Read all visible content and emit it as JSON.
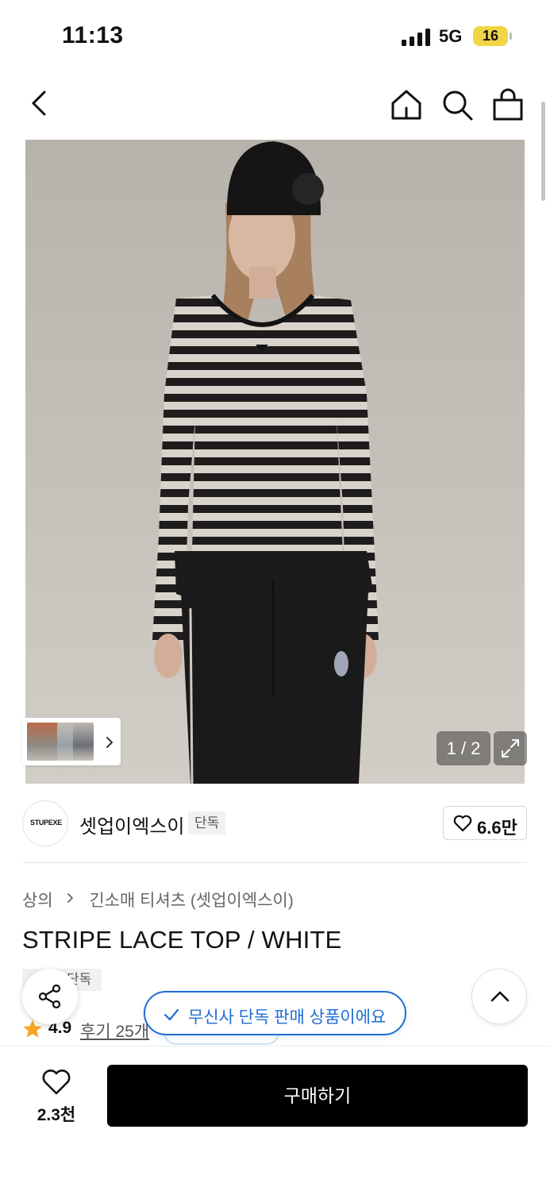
{
  "status_bar": {
    "time": "11:13",
    "network": "5G",
    "battery": "16"
  },
  "product_gallery": {
    "counter": "1 / 2",
    "colors": {
      "background": "#c3beb8",
      "stripe_dark": "#1e1c1c",
      "stripe_light": "#d9d3cc",
      "pants": "#1a1a1a"
    }
  },
  "brand": {
    "logo_text": "STUPEXE",
    "name": "셋업이엑스이",
    "exclusive_tag": "단독",
    "likes": "6.6만"
  },
  "breadcrumb": {
    "category": "상의",
    "subcategory": "긴소매 티셔츠 (셋업이엑스이)"
  },
  "product": {
    "title": "STRIPE LACE TOP / WHITE",
    "tag": "단독",
    "rating": "4.9",
    "review_link": "후기 25개"
  },
  "toast": {
    "text": "무신사 단독 판매 상품이에요",
    "accent_color": "#1f6ed4"
  },
  "bottom_bar": {
    "like_count": "2.3천",
    "buy_label": "구매하기"
  },
  "icons": [
    "back-icon",
    "home-icon",
    "search-icon",
    "bag-icon",
    "expand-icon",
    "heart-icon",
    "star-icon",
    "share-icon",
    "chevron-up-icon",
    "check-icon"
  ]
}
